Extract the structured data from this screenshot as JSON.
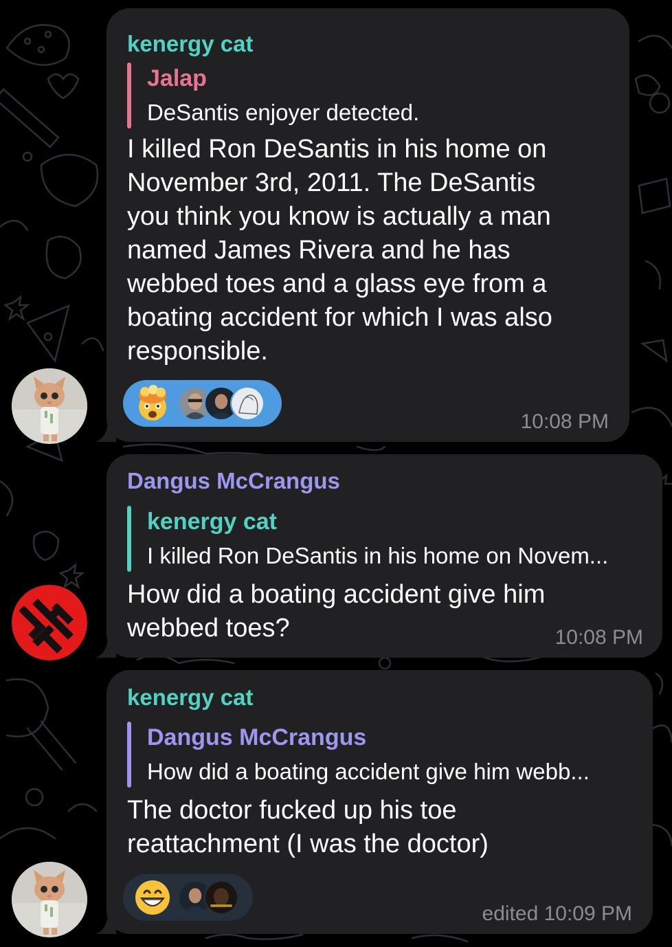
{
  "colors": {
    "background": "#000000",
    "bubble": "#212124",
    "teal_name": "#52d2c3",
    "pink_name": "#e8758e",
    "purple_name": "#9d97ef",
    "time": "#8b8d92",
    "reaction_active": "#4e9be2",
    "reaction_inactive": "#262f3c"
  },
  "messages": [
    {
      "sender": "kenergy cat",
      "reply": {
        "name": "Jalap",
        "text": "DeSantis enjoyer detected."
      },
      "text": "I killed Ron DeSantis in his home on\nNovember 3rd, 2011. The DeSantis\nyou think you know is actually a man\nnamed James Rivera and he has\nwebbed toes and a glass eye from a\nboating accident for which I was also\nresponsible.",
      "reaction_emoji": "exploding-head-emoji",
      "time": "10:08 PM"
    },
    {
      "sender": "Dangus McCrangus",
      "reply": {
        "name": "kenergy cat",
        "text": "I killed Ron DeSantis in his home on Novem..."
      },
      "text": "How did a boating accident give him\nwebbed toes?",
      "time": "10:08 PM"
    },
    {
      "sender": "kenergy cat",
      "reply": {
        "name": "Dangus McCrangus",
        "text": "How did a boating accident give him webb..."
      },
      "text": "The doctor fucked up his toe\nreattachment (I was the doctor)",
      "reaction_emoji": "grinning-face-emoji",
      "time": "edited 10:09 PM"
    }
  ]
}
